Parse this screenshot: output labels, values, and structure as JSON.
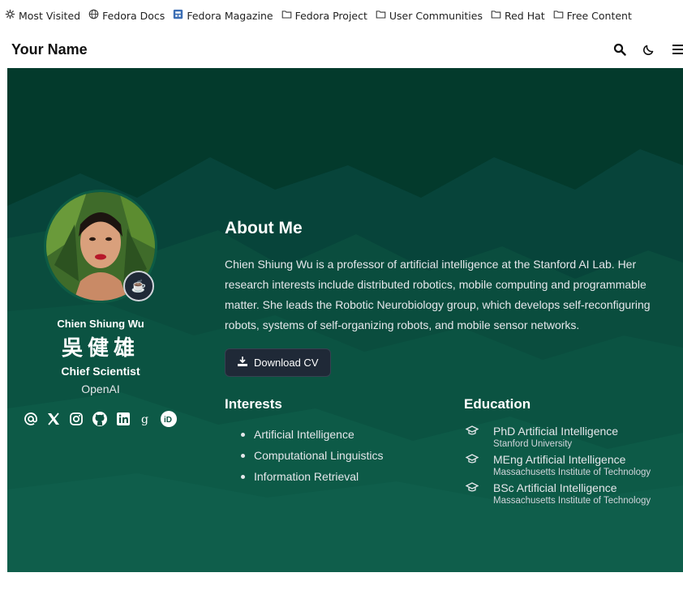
{
  "bookmarks": [
    {
      "icon": "gear-icon",
      "label": "Most Visited"
    },
    {
      "icon": "globe-icon",
      "label": "Fedora Docs"
    },
    {
      "icon": "magazine-icon",
      "label": "Fedora Magazine"
    },
    {
      "icon": "folder-icon",
      "label": "Fedora Project"
    },
    {
      "icon": "folder-icon",
      "label": "User Communities"
    },
    {
      "icon": "folder-icon",
      "label": "Red Hat"
    },
    {
      "icon": "folder-icon",
      "label": "Free Content"
    }
  ],
  "navbar": {
    "brand": "Your Name",
    "icons": [
      "search-icon",
      "moon-icon",
      "menu-icon"
    ]
  },
  "profile": {
    "name": "Chien Shiung Wu",
    "name_cjk": "吳健雄",
    "role": "Chief Scientist",
    "organization": "OpenAI",
    "status_emoji": "☕",
    "socials": [
      "email-icon",
      "x-twitter-icon",
      "instagram-icon",
      "github-icon",
      "linkedin-icon",
      "google-scholar-icon",
      "orcid-icon"
    ]
  },
  "about": {
    "heading": "About Me",
    "bio": "Chien Shiung Wu is a professor of artificial intelligence at the Stanford AI Lab. Her research interests include distributed robotics, mobile computing and programmable matter. She leads the Robotic Neurobiology group, which develops self-reconfiguring robots, systems of self-organizing robots, and mobile sensor networks.",
    "cv_button": "Download CV"
  },
  "interests": {
    "heading": "Interests",
    "items": [
      "Artificial Intelligence",
      "Computational Linguistics",
      "Information Retrieval"
    ]
  },
  "education": {
    "heading": "Education",
    "items": [
      {
        "degree": "PhD Artificial Intelligence",
        "institution": "Stanford University"
      },
      {
        "degree": "MEng Artificial Intelligence",
        "institution": "Massachusetts Institute of Technology"
      },
      {
        "degree": "BSc Artificial Intelligence",
        "institution": "Massachusetts Institute of Technology"
      }
    ]
  },
  "colors": {
    "hero_dark": "#03382a",
    "hero_mid": "#0a4d3b",
    "hero_light": "#0f5d49",
    "button_bg": "#1f2937"
  }
}
